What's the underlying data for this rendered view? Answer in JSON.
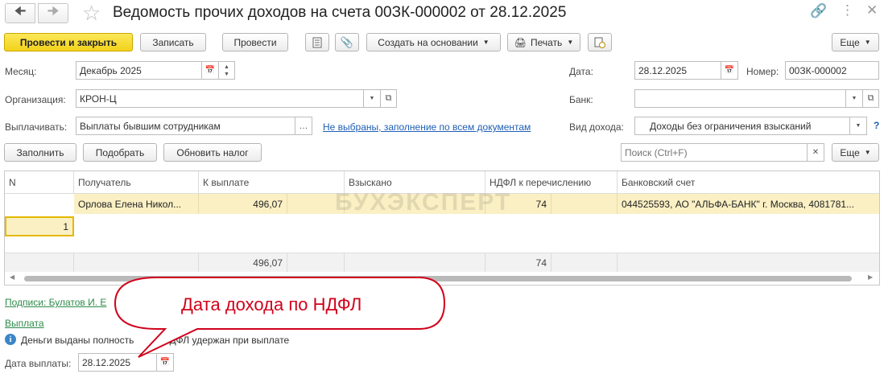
{
  "window": {
    "title": "Ведомость прочих доходов на счета 00ЗК-000002 от 28.12.2025"
  },
  "toolbar": {
    "post_close": "Провести и закрыть",
    "save": "Записать",
    "post": "Провести",
    "create_based": "Создать на основании",
    "print": "Печать",
    "more": "Еще"
  },
  "form": {
    "month_label": "Месяц:",
    "month_value": "Декабрь 2025",
    "org_label": "Организация:",
    "org_value": "КРОН-Ц",
    "pay_label": "Выплачивать:",
    "pay_value": "Выплаты бывшим сотрудникам",
    "docs_link": "Не выбраны, заполнение по всем документам",
    "date_label": "Дата:",
    "date_value": "28.12.2025",
    "number_label": "Номер:",
    "number_value": "00ЗК-000002",
    "bank_label": "Банк:",
    "bank_value": "",
    "income_type_label": "Вид дохода:",
    "income_type_value": "Доходы без ограничения взысканий",
    "help": "?"
  },
  "table_toolbar": {
    "fill": "Заполнить",
    "pick": "Подобрать",
    "update_tax": "Обновить налог",
    "search_placeholder": "Поиск (Ctrl+F)",
    "more": "Еще"
  },
  "table": {
    "columns": [
      "N",
      "Получатель",
      "К выплате",
      "Взыскано",
      "НДФЛ к перечислению",
      "Банковский счет"
    ],
    "rows": [
      {
        "n": "1",
        "recipient": "Орлова Елена Никол...",
        "to_pay": "496,07",
        "collected": "",
        "ndfl": "74",
        "account": "044525593, АО \"АЛЬФА-БАНК\" г. Москва, 4081781..."
      }
    ],
    "totals": {
      "to_pay": "496,07",
      "ndfl": "74"
    }
  },
  "watermark": "БУХЭКСПЕРТ",
  "footer": {
    "signatures_link": "Подписи: Булатов И. Е",
    "payment_link": "Выплата",
    "info_text": "Деньги выданы полность",
    "info_text2": "НДФЛ удержан при выплате",
    "pay_date_label": "Дата выплаты:",
    "pay_date_value": "28.12.2025"
  },
  "callout": {
    "text": "Дата дохода по НДФЛ"
  },
  "colors": {
    "primary_button": "#f3d21a",
    "row_highlight": "#fbf0c4",
    "link": "#1f5fb5",
    "green_link": "#2e8b4a",
    "callout_border": "#d0021b",
    "callout_text": "#d0021b"
  }
}
